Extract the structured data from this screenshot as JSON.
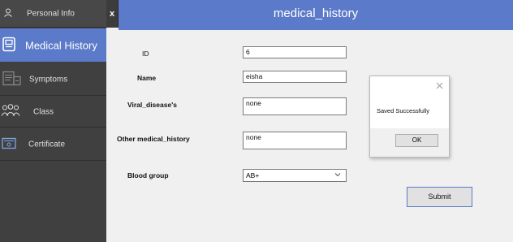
{
  "window": {
    "title": "medical_history",
    "close_glyph": "x"
  },
  "sidebar": {
    "items": [
      {
        "label": "Personal Info",
        "icon": "person-icon"
      },
      {
        "label": "Medical History",
        "icon": "clipboard-icon",
        "active": true
      },
      {
        "label": "Symptoms",
        "icon": "symptoms-icon"
      },
      {
        "label": "Class",
        "icon": "group-icon"
      },
      {
        "label": "Certificate",
        "icon": "certificate-icon"
      }
    ]
  },
  "form": {
    "id_label": "ID",
    "id_value": "6",
    "name_label": "Name",
    "name_value": "eisha",
    "viral_label": "Viral_disease's",
    "viral_value": "none",
    "other_label": "Other medical_history",
    "other_value": "none",
    "blood_label": "Blood group",
    "blood_value": "AB+",
    "submit_label": "Submit"
  },
  "dialog": {
    "message": "Saved Successfully",
    "ok_label": "OK"
  },
  "colors": {
    "accent": "#5b7ac9",
    "sidebar_bg": "#404040",
    "content_bg": "#f0f0f0"
  }
}
